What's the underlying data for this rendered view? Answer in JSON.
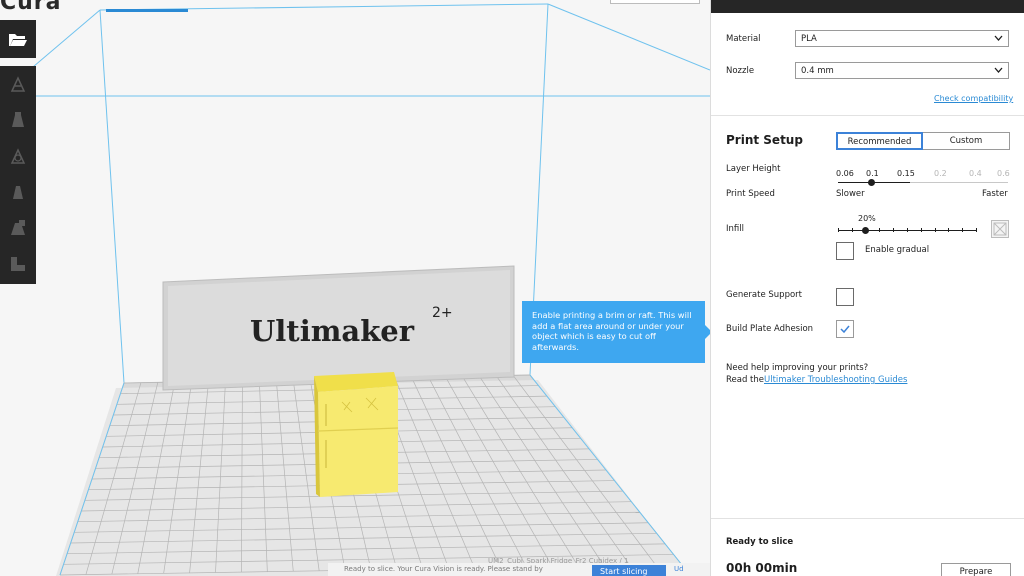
{
  "app": {
    "logo_text": "Cura"
  },
  "toolbar": {
    "open_icon": "folder-open-icon",
    "tools": [
      "translate-icon",
      "scale-icon",
      "rotate-icon",
      "mirror-icon",
      "per-model-settings-icon",
      "support-blocker-icon"
    ]
  },
  "viewport": {
    "printer_brand": "Ultimaker",
    "printer_model": "2+",
    "tooltip": "Enable printing a brim or raft. This will add a flat area around or under your object which is easy to cut off afterwards.",
    "status_message": "Ready to slice. Your Cura Vision is ready. Please stand by",
    "model_label": "UM2_Cubi_Sparkl Fridge_Fr2 Cubidex / 1",
    "slice_button": "Start slicing",
    "more_link": "Ud"
  },
  "sidebar": {
    "material_label": "Material",
    "material_value": "PLA",
    "nozzle_label": "Nozzle",
    "nozzle_value": "0.4 mm",
    "check_compatibility": "Check compatibility",
    "print_setup_title": "Print Setup",
    "mode_recommended": "Recommended",
    "mode_custom": "Custom",
    "layer_height_label": "Layer Height",
    "layer_heights": [
      "0.06",
      "0.1",
      "0.15",
      "0.2",
      "0.4",
      "0.6"
    ],
    "layer_height_selected": "0.1",
    "print_speed_label": "Print Speed",
    "speed_slow": "Slower",
    "speed_fast": "Faster",
    "infill_label": "Infill",
    "infill_value": "20%",
    "infill_fraction": 0.2,
    "enable_gradual": "Enable gradual",
    "generate_support_label": "Generate Support",
    "generate_support_checked": false,
    "build_plate_adhesion_label": "Build Plate Adhesion",
    "build_plate_adhesion_checked": true,
    "help_line1": "Need help improving your prints?",
    "help_line2": "Read the ",
    "help_link": "Ultimaker Troubleshooting Guides",
    "ready_label": "Ready to slice",
    "print_time": "00h 00min",
    "prepare_button": "Prepare"
  },
  "colors": {
    "accent": "#3c82d8",
    "tooltip_bg": "#3ea7f0",
    "model_yellow": "#f5e86c",
    "toolbar_bg": "#262626"
  }
}
